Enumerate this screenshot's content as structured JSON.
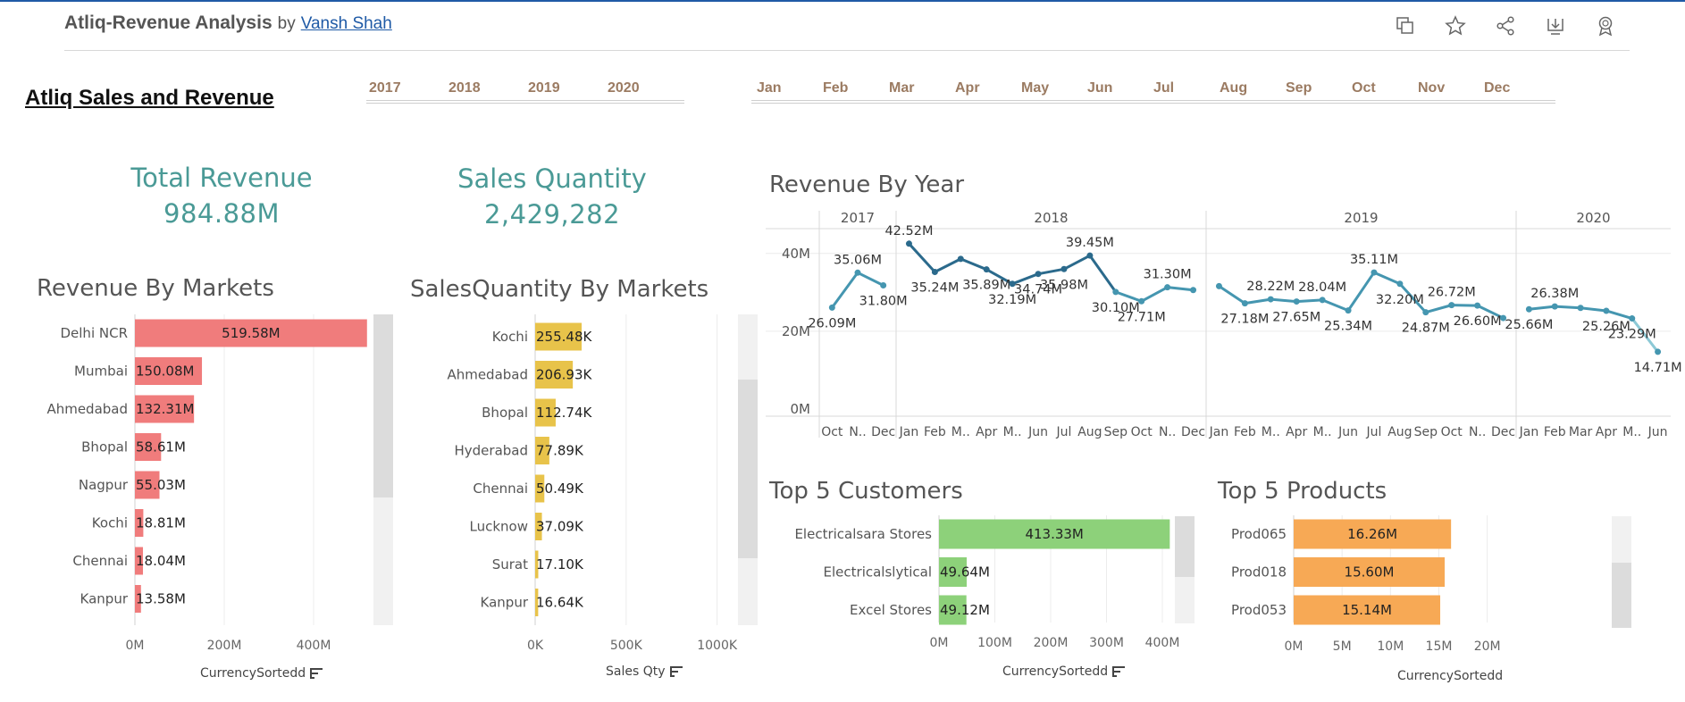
{
  "header": {
    "title": "Atliq-Revenue Analysis",
    "by": "by",
    "author": "Vansh Shah",
    "icons": [
      "duplicate-icon",
      "star-icon",
      "share-icon",
      "download-icon",
      "badge-icon"
    ]
  },
  "dashboard": {
    "title": "Atliq Sales and Revenue",
    "year_filter": [
      "2017",
      "2018",
      "2019",
      "2020"
    ],
    "month_filter": [
      "Jan",
      "Feb",
      "Mar",
      "Apr",
      "May",
      "Jun",
      "Jul",
      "Aug",
      "Sep",
      "Oct",
      "Nov",
      "Dec"
    ],
    "kpis": {
      "revenue_label": "Total Revenue",
      "revenue_value": "984.88M",
      "qty_label": "Sales Quantity",
      "qty_value": "2,429,282"
    },
    "titles": {
      "rev_markets": "Revenue By Markets",
      "qty_markets": "SalesQuantity By Markets",
      "rev_year": "Revenue By Year",
      "customers": "Top 5 Customers",
      "products": "Top 5 Products"
    },
    "axis_titles": {
      "rev_markets": "CurrencySortedd",
      "qty_markets": "Sales Qty",
      "customers": "CurrencySortedd",
      "products": "CurrencySortedd"
    },
    "colors": {
      "revenue_bar": "#f07c7c",
      "qty_bar": "#e8c34a",
      "customer_bar": "#8dd17a",
      "product_bar": "#f7a955",
      "line": "#4596b0",
      "line_dark": "#2b6a8c",
      "kpi_text": "#4a9a96"
    }
  },
  "chart_data": [
    {
      "id": "rev_markets",
      "type": "bar",
      "orientation": "horizontal",
      "title": "Revenue By Markets",
      "xlabel": "CurrencySortedd",
      "categories": [
        "Delhi NCR",
        "Mumbai",
        "Ahmedabad",
        "Bhopal",
        "Nagpur",
        "Kochi",
        "Chennai",
        "Kanpur"
      ],
      "values": [
        519.58,
        150.08,
        132.31,
        58.61,
        55.03,
        18.81,
        18.04,
        13.58
      ],
      "labels": [
        "519.58M",
        "150.08M",
        "132.31M",
        "58.61M",
        "55.03M",
        "18.81M",
        "18.04M",
        "13.58M"
      ],
      "xticks": [
        "0M",
        "200M",
        "400M"
      ],
      "xlim": [
        0,
        540
      ]
    },
    {
      "id": "qty_markets",
      "type": "bar",
      "orientation": "horizontal",
      "title": "SalesQuantity By Markets",
      "xlabel": "Sales Qty",
      "categories": [
        "Kochi",
        "Ahmedabad",
        "Bhopal",
        "Hyderabad",
        "Chennai",
        "Lucknow",
        "Surat",
        "Kanpur"
      ],
      "values": [
        255.48,
        206.93,
        112.74,
        77.89,
        50.49,
        37.09,
        17.1,
        16.64
      ],
      "labels": [
        "255.48K",
        "206.93K",
        "112.74K",
        "77.89K",
        "50.49K",
        "37.09K",
        "17.10K",
        "16.64K"
      ],
      "xticks": [
        "0K",
        "500K",
        "1000K"
      ],
      "xlim": [
        0,
        1100
      ]
    },
    {
      "id": "rev_year",
      "type": "line",
      "title": "Revenue By Year",
      "ylim": [
        0,
        45
      ],
      "yticks": [
        "0M",
        "20M",
        "40M"
      ],
      "panels": [
        {
          "year": "2017",
          "months": [
            "Oct",
            "N..",
            "Dec"
          ],
          "values": [
            26.09,
            35.06,
            31.8
          ],
          "labels": [
            "26.09M",
            "35.06M",
            "31.80M"
          ]
        },
        {
          "year": "2018",
          "months": [
            "Jan",
            "Feb",
            "M..",
            "Apr",
            "M..",
            "Jun",
            "Jul",
            "Aug",
            "Sep",
            "Oct",
            "N..",
            "Dec"
          ],
          "values": [
            42.52,
            35.24,
            38.6,
            35.89,
            32.19,
            34.74,
            35.98,
            39.45,
            30.1,
            27.71,
            31.3,
            30.6
          ],
          "labels": [
            "42.52M",
            "35.24M",
            "",
            "35.89M",
            "32.19M",
            "34.74M",
            "35.98M",
            "39.45M",
            "30.10M",
            "27.71M",
            "31.30M",
            ""
          ]
        },
        {
          "year": "2019",
          "months": [
            "Jan",
            "Feb",
            "M..",
            "Apr",
            "M..",
            "Jun",
            "Jul",
            "Aug",
            "Sep",
            "Oct",
            "N..",
            "Dec"
          ],
          "values": [
            31.6,
            27.18,
            28.22,
            27.65,
            28.04,
            25.34,
            35.11,
            32.2,
            24.87,
            26.72,
            26.6,
            23.4
          ],
          "labels": [
            "",
            "27.18M",
            "28.22M",
            "27.65M",
            "28.04M",
            "25.34M",
            "35.11M",
            "32.20M",
            "24.87M",
            "26.72M",
            "26.60M",
            ""
          ]
        },
        {
          "year": "2020",
          "months": [
            "Jan",
            "Feb",
            "Mar",
            "Apr",
            "M..",
            "Jun"
          ],
          "values": [
            25.66,
            26.38,
            26.0,
            25.26,
            23.29,
            14.71
          ],
          "labels": [
            "25.66M",
            "26.38M",
            "",
            "25.26M",
            "23.29M",
            "14.71M"
          ]
        }
      ]
    },
    {
      "id": "customers",
      "type": "bar",
      "orientation": "horizontal",
      "title": "Top 5 Customers",
      "xlabel": "CurrencySortedd",
      "categories": [
        "Electricalsara Stores",
        "Electricalslytical",
        "Excel Stores"
      ],
      "values": [
        413.33,
        49.64,
        49.12
      ],
      "labels": [
        "413.33M",
        "49.64M",
        "49.12M"
      ],
      "xticks": [
        "0M",
        "100M",
        "200M",
        "300M",
        "400M"
      ],
      "xlim": [
        0,
        440
      ]
    },
    {
      "id": "products",
      "type": "bar",
      "orientation": "horizontal",
      "title": "Top 5 Products",
      "xlabel": "CurrencySortedd",
      "categories": [
        "Prod065",
        "Prod018",
        "Prod053"
      ],
      "values": [
        16.26,
        15.6,
        15.14
      ],
      "labels": [
        "16.26M",
        "15.60M",
        "15.14M"
      ],
      "xticks": [
        "0M",
        "5M",
        "10M",
        "15M",
        "20M"
      ],
      "xlim": [
        0,
        24
      ]
    }
  ]
}
